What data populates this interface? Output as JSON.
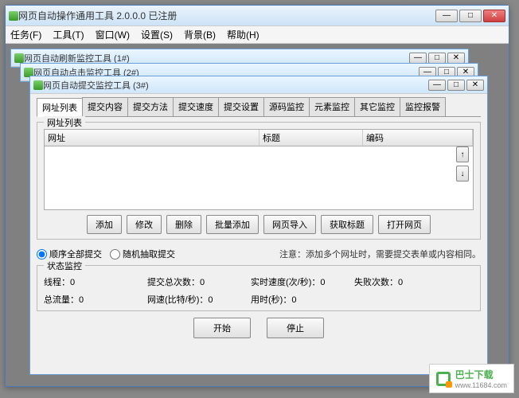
{
  "main": {
    "title": "网页自动操作通用工具 2.0.0.0 已注册",
    "menu": [
      "任务(F)",
      "工具(T)",
      "窗口(W)",
      "设置(S)",
      "背景(B)",
      "帮助(H)"
    ]
  },
  "child1": {
    "title": "网页自动刷新监控工具  (1#)"
  },
  "child2": {
    "title": "网页自动点击监控工具  (2#)"
  },
  "child3": {
    "title": "网页自动提交监控工具  (3#)",
    "tabs": [
      "网址列表",
      "提交内容",
      "提交方法",
      "提交速度",
      "提交设置",
      "源码监控",
      "元素监控",
      "其它监控",
      "监控报警"
    ],
    "list_group": "网址列表",
    "cols": {
      "url": "网址",
      "title": "标题",
      "enc": "编码"
    },
    "btns": {
      "add": "添加",
      "edit": "修改",
      "del": "删除",
      "batch": "批量添加",
      "import": "网页导入",
      "gettitle": "获取标题",
      "open": "打开网页"
    },
    "radio": {
      "seq": "顺序全部提交",
      "rand": "随机抽取提交"
    },
    "note": "注意：添加多个网址时，需要提交表单或内容相同。",
    "status_group": "状态监控",
    "stats": {
      "threads_l": "线程：",
      "threads_v": "0",
      "total_l": "提交总次数：",
      "total_v": "0",
      "speed_l": "实时速度(次/秒)：",
      "speed_v": "0",
      "fail_l": "失败次数：",
      "fail_v": "0",
      "traffic_l": "总流量：",
      "traffic_v": "0",
      "net_l": "网速(比特/秒)：",
      "net_v": "0",
      "time_l": "用时(秒)：",
      "time_v": "0"
    },
    "start": "开始",
    "stop": "停止"
  },
  "footer": {
    "brand": "巴士下载",
    "url": "www.11684.com"
  }
}
